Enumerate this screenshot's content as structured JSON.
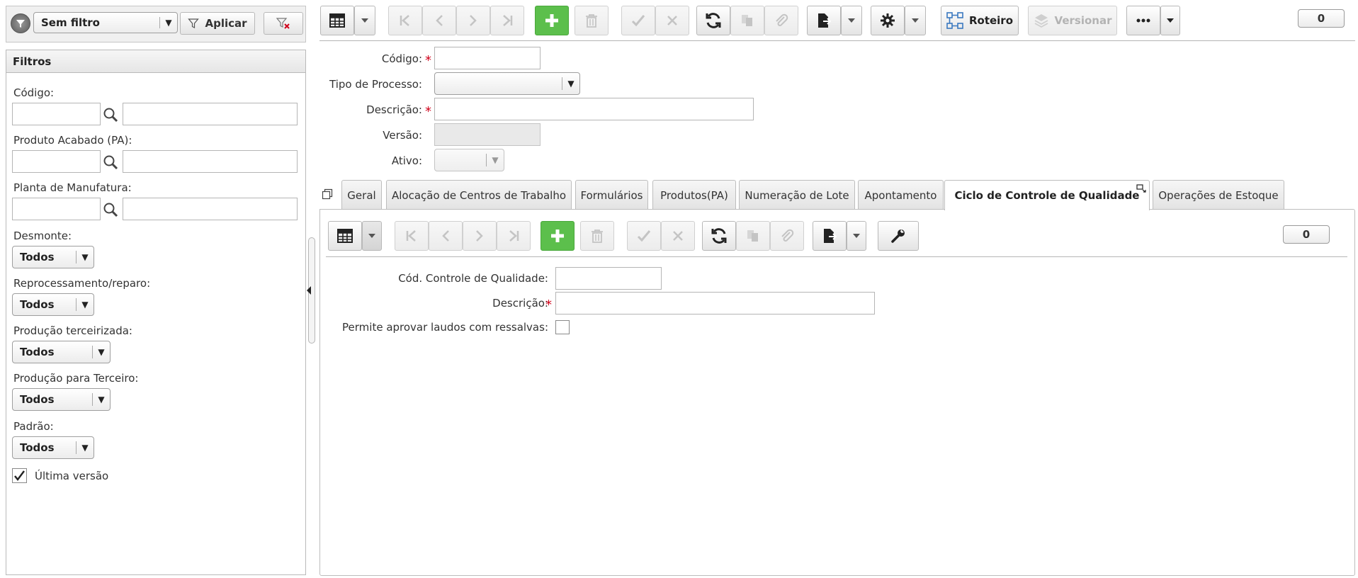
{
  "filter_bar": {
    "selected_filter": "Sem filtro",
    "apply_label": "Aplicar"
  },
  "filters": {
    "title": "Filtros",
    "codigo_label": "Código:",
    "produto_label": "Produto Acabado (PA):",
    "planta_label": "Planta de Manufatura:",
    "desmonte_label": "Desmonte:",
    "desmonte_value": "Todos",
    "reprocessamento_label": "Reprocessamento/reparo:",
    "reprocessamento_value": "Todos",
    "terceirizada_label": "Produção terceirizada:",
    "terceirizada_value": "Todos",
    "para_terceiro_label": "Produção para Terceiro:",
    "para_terceiro_value": "Todos",
    "padrao_label": "Padrão:",
    "padrao_value": "Todos",
    "ultima_versao_label": "Última versão",
    "ultima_versao_checked": true
  },
  "toolbar": {
    "roteiro_label": "Roteiro",
    "versionar_label": "Versionar",
    "counter": "0"
  },
  "form": {
    "codigo_label": "Código:",
    "tipo_processo_label": "Tipo de Processo:",
    "descricao_label": "Descrição:",
    "versao_label": "Versão:",
    "ativo_label": "Ativo:"
  },
  "tabs": [
    {
      "label": "Geral"
    },
    {
      "label": "Alocação de Centros de Trabalho"
    },
    {
      "label": "Formulários"
    },
    {
      "label": "Produtos(PA)"
    },
    {
      "label": "Numeração de Lote"
    },
    {
      "label": "Apontamento"
    },
    {
      "label": "Ciclo de Controle de Qualidade"
    },
    {
      "label": "Operações de Estoque"
    }
  ],
  "active_tab": "Ciclo de Controle de Qualidade",
  "subtoolbar": {
    "counter": "0"
  },
  "subform": {
    "cod_controle_label": "Cód. Controle de Qualidade:",
    "descricao_label": "Descrição:",
    "permite_label": "Permite aprovar laudos com ressalvas:"
  },
  "colors": {
    "accent_green": "#5cbf4c",
    "required_red": "#d0021b",
    "border_gray": "#b5b5b5"
  }
}
